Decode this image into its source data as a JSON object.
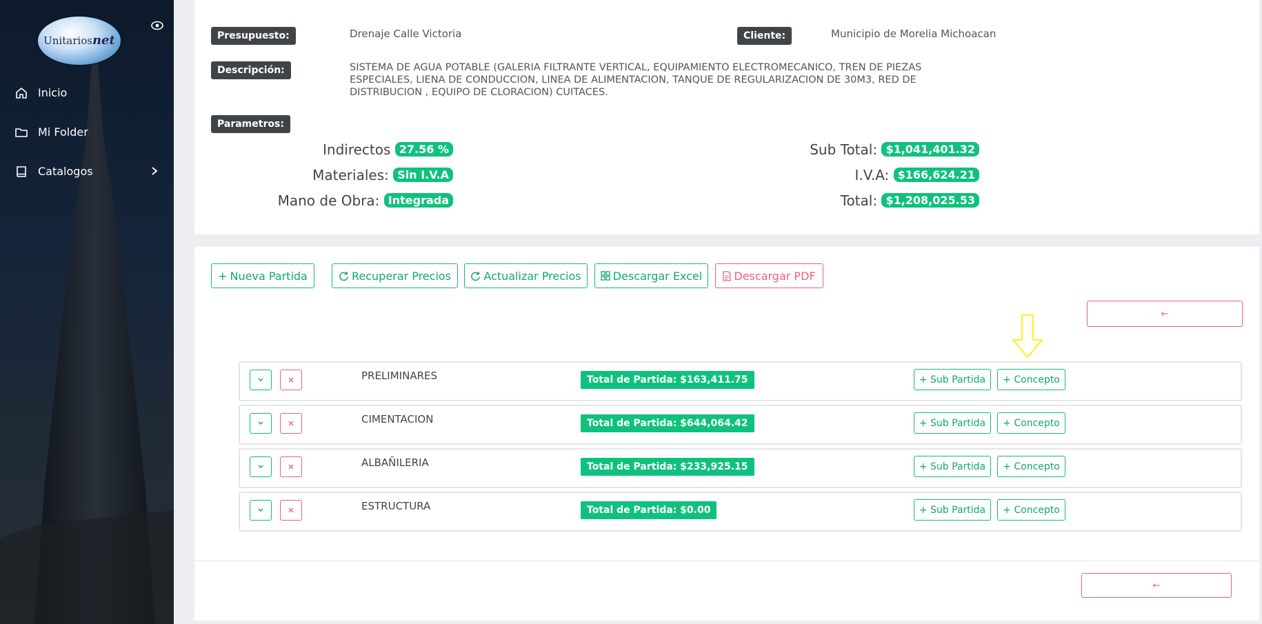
{
  "sidebar": {
    "logo_text": "Unitarios",
    "logo_suffix": "net",
    "items": [
      {
        "label": "Inicio",
        "icon": "home-icon"
      },
      {
        "label": "Mi Folder",
        "icon": "folder-icon"
      },
      {
        "label": "Catalogos",
        "icon": "book-icon",
        "has_submenu": true
      }
    ]
  },
  "budget": {
    "presupuesto_label": "Presupuesto:",
    "presupuesto_value": "Drenaje Calle Victoria",
    "cliente_label": "Cliente:",
    "cliente_value": "Municipio de Morelia Michoacan",
    "descripcion_label": "Descripción:",
    "descripcion_value": "SISTEMA DE AGUA POTABLE (GALERIA FILTRANTE VERTICAL, EQUIPAMIENTO ELECTROMECANICO, TREN DE PIEZAS ESPECIALES, LIENA DE CONDUCCION, LINEA DE ALIMENTACION, TANQUE DE REGULARIZACION DE 30M3, RED DE DISTRIBUCION , EQUIPO DE CLORACION) CUITACES.",
    "parametros_label": "Parametros:",
    "params_left": [
      {
        "label": "Indirectos",
        "value": "27.56 %"
      },
      {
        "label": "Materiales:",
        "value": "Sin I.V.A"
      },
      {
        "label": "Mano de Obra:",
        "value": "Integrada"
      }
    ],
    "params_right": [
      {
        "label": "Sub Total:",
        "value": "$1,041,401.32"
      },
      {
        "label": "I.V.A:",
        "value": "$166,624.21"
      },
      {
        "label": "Total:",
        "value": "$1,208,025.53"
      }
    ]
  },
  "toolbar": {
    "nueva_partida": "Nueva Partida",
    "recuperar_precios": "Recuperar Precios",
    "actualizar_precios": "Actualizar Precios",
    "descargar_excel": "Descargar Excel",
    "descargar_pdf": "Descargar PDF"
  },
  "back_arrow": "←",
  "partidas": [
    {
      "name": "PRELIMINARES",
      "total": "Total de Partida: $163,411.75"
    },
    {
      "name": "CIMENTACION",
      "total": "Total de Partida: $644,064.42"
    },
    {
      "name": "ALBAÑILERIA",
      "total": "Total de Partida: $233,925.15"
    },
    {
      "name": "ESTRUCTURA",
      "total": "Total de Partida: $0.00"
    }
  ],
  "row_actions": {
    "sub_partida": "+ Sub Partida",
    "concepto": "+ Concepto"
  },
  "colors": {
    "accent_green": "#10c17d",
    "danger_red": "#f25e74",
    "tag_dark": "#3f4448",
    "annotation_yellow": "#ffef3a"
  }
}
